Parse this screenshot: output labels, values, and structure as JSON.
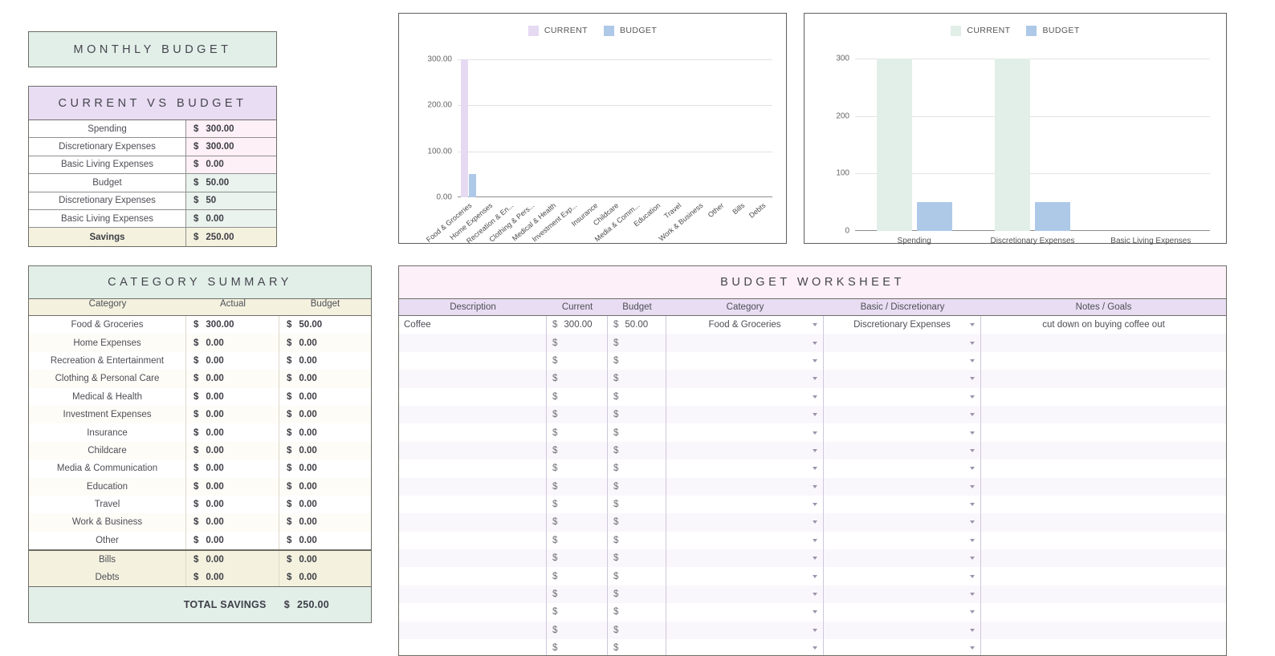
{
  "monthly_budget": {
    "title": "MONTHLY BUDGET"
  },
  "current_vs_budget": {
    "title": "CURRENT VS BUDGET",
    "currency": "$",
    "rows": [
      {
        "label": "Spending",
        "value": "300.00",
        "tint": "pink"
      },
      {
        "label": "Discretionary Expenses",
        "value": "300.00",
        "tint": "pink"
      },
      {
        "label": "Basic Living Expenses",
        "value": "0.00",
        "tint": "pink"
      },
      {
        "label": "Budget",
        "value": "50.00",
        "tint": "mint"
      },
      {
        "label": "Discretionary Expenses",
        "value": "50",
        "tint": "mint"
      },
      {
        "label": "Basic Living Expenses",
        "value": "0.00",
        "tint": "mint"
      },
      {
        "label": "Savings",
        "value": "250.00",
        "tint": "cream"
      }
    ]
  },
  "category_summary": {
    "title": "CATEGORY SUMMARY",
    "currency": "$",
    "columns": [
      "Category",
      "Actual",
      "Budget"
    ],
    "rows": [
      {
        "category": "Food & Groceries",
        "actual": "300.00",
        "budget": "50.00"
      },
      {
        "category": "Home Expenses",
        "actual": "0.00",
        "budget": "0.00"
      },
      {
        "category": "Recreation & Entertainment",
        "actual": "0.00",
        "budget": "0.00"
      },
      {
        "category": "Clothing & Personal Care",
        "actual": "0.00",
        "budget": "0.00"
      },
      {
        "category": "Medical & Health",
        "actual": "0.00",
        "budget": "0.00"
      },
      {
        "category": "Investment Expenses",
        "actual": "0.00",
        "budget": "0.00"
      },
      {
        "category": "Insurance",
        "actual": "0.00",
        "budget": "0.00"
      },
      {
        "category": "Childcare",
        "actual": "0.00",
        "budget": "0.00"
      },
      {
        "category": "Media & Communication",
        "actual": "0.00",
        "budget": "0.00"
      },
      {
        "category": "Education",
        "actual": "0.00",
        "budget": "0.00"
      },
      {
        "category": "Travel",
        "actual": "0.00",
        "budget": "0.00"
      },
      {
        "category": "Work & Business",
        "actual": "0.00",
        "budget": "0.00"
      },
      {
        "category": "Other",
        "actual": "0.00",
        "budget": "0.00"
      }
    ],
    "highlight_rows": [
      {
        "category": "Bills",
        "actual": "0.00",
        "budget": "0.00"
      },
      {
        "category": "Debts",
        "actual": "0.00",
        "budget": "0.00"
      }
    ],
    "total_label": "TOTAL SAVINGS",
    "total_value": "250.00"
  },
  "budget_worksheet": {
    "title": "BUDGET WORKSHEET",
    "currency": "$",
    "columns": [
      "Description",
      "Current",
      "Budget",
      "Category",
      "Basic / Discretionary",
      "Notes / Goals"
    ],
    "rows": [
      {
        "description": "Coffee",
        "current": "300.00",
        "budget": "50.00",
        "category": "Food & Groceries",
        "basic_discretionary": "Discretionary Expenses",
        "notes": "cut down on buying coffee out"
      }
    ],
    "empty_row_count": 18
  },
  "chart_data": [
    {
      "type": "bar",
      "title": "",
      "legend": [
        "CURRENT",
        "BUDGET"
      ],
      "legend_position": "top-center",
      "colors": {
        "CURRENT": "#e6daf2",
        "BUDGET": "#aec9e8"
      },
      "categories": [
        "Food & Groceries",
        "Home Expenses",
        "Recreation & En...",
        "Clothing & Pers...",
        "Medical & Health",
        "Investment Exp...",
        "Insurance",
        "Childcare",
        "Media & Comm...",
        "Education",
        "Travel",
        "Work & Business",
        "Other",
        "Bills",
        "Debts"
      ],
      "series": [
        {
          "name": "CURRENT",
          "values": [
            300,
            0,
            0,
            0,
            0,
            0,
            0,
            0,
            0,
            0,
            0,
            0,
            0,
            0,
            0
          ]
        },
        {
          "name": "BUDGET",
          "values": [
            50,
            0,
            0,
            0,
            0,
            0,
            0,
            0,
            0,
            0,
            0,
            0,
            0,
            0,
            0
          ]
        }
      ],
      "ytick_labels": [
        "0.00",
        "100.00",
        "200.00",
        "300.00"
      ],
      "ylim": [
        0,
        300
      ],
      "xlabel": "",
      "ylabel": "",
      "grid": true
    },
    {
      "type": "bar",
      "title": "",
      "legend": [
        "CURRENT",
        "BUDGET"
      ],
      "legend_position": "top-center",
      "colors": {
        "CURRENT": "#e2efe9",
        "BUDGET": "#aec9e8"
      },
      "categories": [
        "Spending",
        "Discretionary Expenses",
        "Basic Living Expenses"
      ],
      "series": [
        {
          "name": "CURRENT",
          "values": [
            300,
            300,
            0
          ]
        },
        {
          "name": "BUDGET",
          "values": [
            50,
            50,
            0
          ]
        }
      ],
      "ytick_labels": [
        "0",
        "100",
        "200",
        "300"
      ],
      "ylim": [
        0,
        300
      ],
      "xlabel": "",
      "ylabel": "",
      "grid": true
    }
  ]
}
